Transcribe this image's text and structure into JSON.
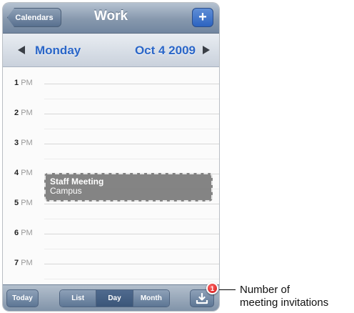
{
  "navbar": {
    "back_label": "Calendars",
    "title": "Work",
    "add_label": "+"
  },
  "datebar": {
    "day": "Monday",
    "date": "Oct 4 2009"
  },
  "hours": [
    {
      "num": "1",
      "ampm": "PM"
    },
    {
      "num": "2",
      "ampm": "PM"
    },
    {
      "num": "3",
      "ampm": "PM"
    },
    {
      "num": "4",
      "ampm": "PM"
    },
    {
      "num": "5",
      "ampm": "PM"
    },
    {
      "num": "6",
      "ampm": "PM"
    },
    {
      "num": "7",
      "ampm": "PM"
    }
  ],
  "event": {
    "title": "Staff Meeting",
    "location": "Campus"
  },
  "toolbar": {
    "today_label": "Today",
    "segments": [
      {
        "label": "List"
      },
      {
        "label": "Day"
      },
      {
        "label": "Month"
      }
    ],
    "selected_segment": "Day",
    "inbox_badge": "1"
  },
  "callout": {
    "line1": "Number of",
    "line2": "meeting invitations"
  },
  "colors": {
    "accent_blue": "#2a66c8",
    "badge_red": "#cc1010",
    "bar_steel": "#7f92a8"
  },
  "icons": {
    "prev": "triangle-left-icon",
    "next": "triangle-right-icon",
    "add": "plus-icon",
    "inbox": "invitation-inbox-icon"
  }
}
